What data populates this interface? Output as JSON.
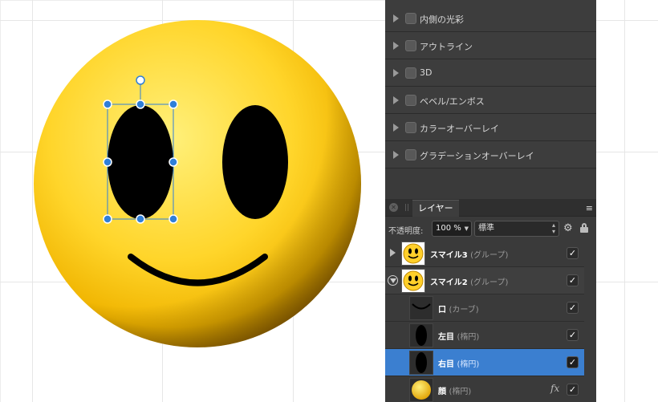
{
  "effects": [
    {
      "label": "内側の光彩",
      "checked": false
    },
    {
      "label": "アウトライン",
      "checked": false
    },
    {
      "label": "3D",
      "checked": false
    },
    {
      "label": "ベベル/エンボス",
      "checked": false
    },
    {
      "label": "カラーオーバーレイ",
      "checked": false
    },
    {
      "label": "グラデーションオーバーレイ",
      "checked": false
    }
  ],
  "layers_panel": {
    "tab_label": "レイヤー",
    "opacity_label": "不透明度:",
    "opacity_value": "100 %",
    "blend_mode": "標準"
  },
  "layers": [
    {
      "name": "スマイル3",
      "type": "(グループ)",
      "visible": true
    },
    {
      "name": "スマイル2",
      "type": "(グループ)",
      "visible": true
    },
    {
      "name": "口",
      "type": "(カーブ)",
      "visible": true
    },
    {
      "name": "左目",
      "type": "(楕円)",
      "visible": true
    },
    {
      "name": "右目",
      "type": "(楕円)",
      "visible": true,
      "selected": true
    },
    {
      "name": "顔",
      "type": "(楕円)",
      "visible": true,
      "fx": "fx"
    }
  ],
  "colors": {
    "selection": "#3b7fd0",
    "face_light": "#ffe45a",
    "face_dark": "#d99a00",
    "handle": "#2f7fd8"
  },
  "icons": {
    "check": "✓"
  }
}
